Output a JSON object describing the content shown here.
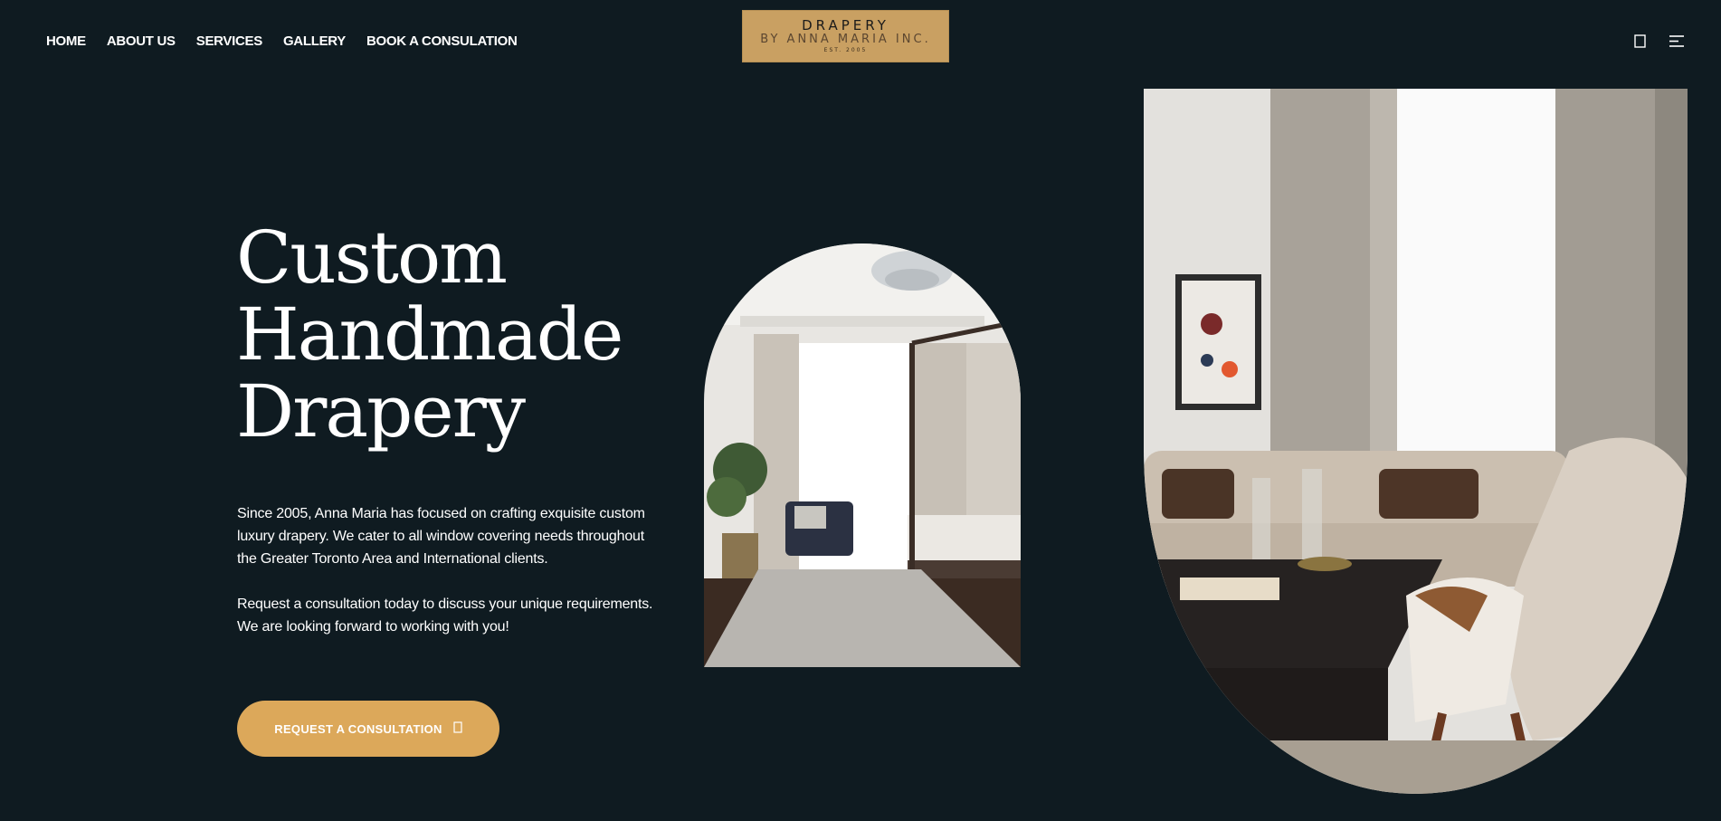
{
  "nav": {
    "items": [
      "HOME",
      "ABOUT US",
      "SERVICES",
      "GALLERY",
      "BOOK A CONSULATION"
    ]
  },
  "logo": {
    "line1": "DRAPERY",
    "line2": "BY ANNA MARIA INC.",
    "line3": "EST. 2005"
  },
  "header_icons": {
    "cart": "shopping-bag-icon",
    "menu": "menu-icon"
  },
  "hero": {
    "title_lines": [
      "Custom",
      "Handmade",
      "Drapery"
    ],
    "paragraph1": "Since 2005, Anna Maria has focused on crafting exquisite custom luxury drapery. We cater to all window covering needs throughout the Greater Toronto Area and International clients.",
    "paragraph2": "Request a consultation today to discuss your unique requirements. We are looking forward to working with you!",
    "cta_label": "REQUEST A CONSULTATION",
    "cta_icon": "arrow-icon"
  },
  "colors": {
    "background": "#0f1b21",
    "accent": "#dca85a",
    "logo_bg": "#c9a062",
    "text": "#ffffff"
  }
}
